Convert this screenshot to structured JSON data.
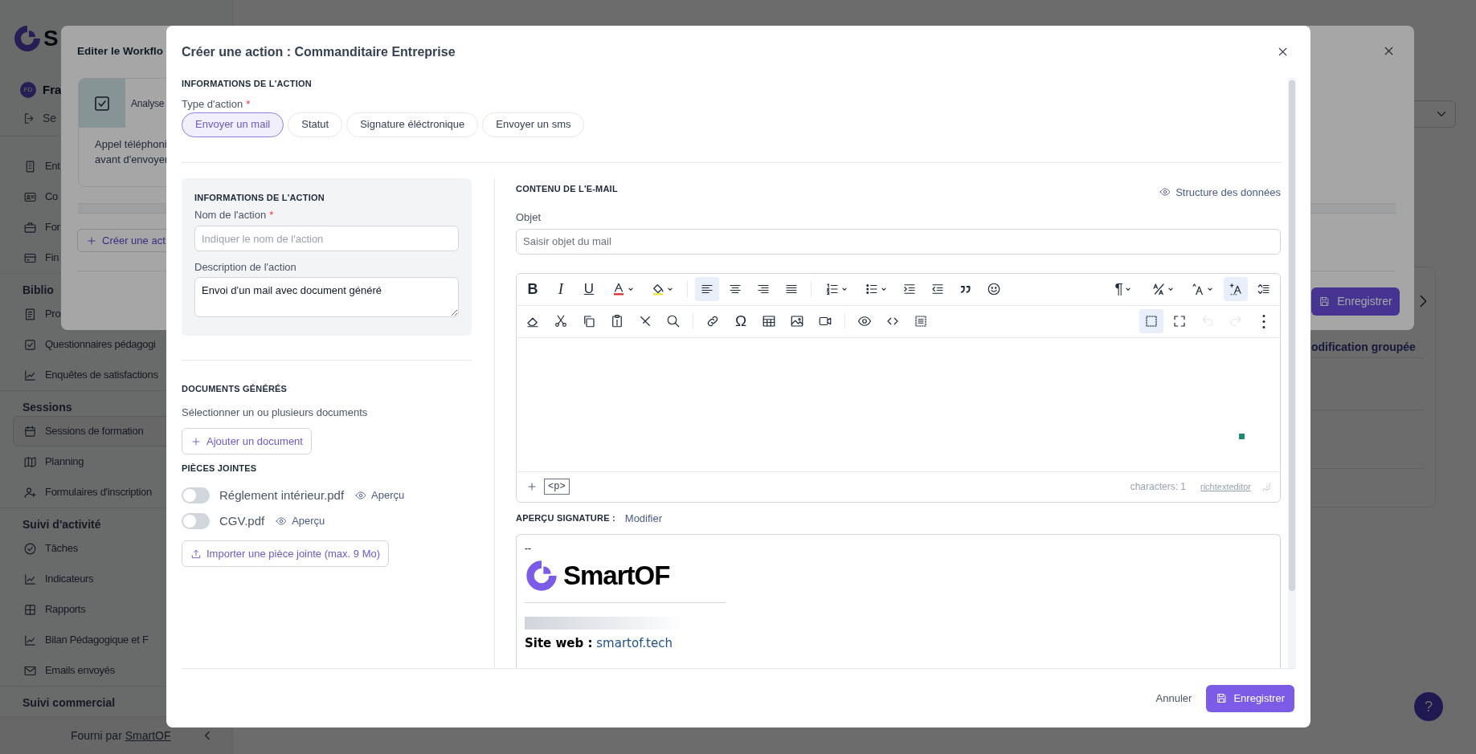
{
  "sidebar": {
    "logo_text": "S",
    "user": {
      "initials": "FD",
      "name": "Fra"
    },
    "logout": "Se",
    "groups": [
      {
        "items": [
          {
            "label": "Ent",
            "selected": false
          },
          {
            "label": "Co",
            "selected": false
          },
          {
            "label": "For",
            "selected": false
          },
          {
            "label": "Fin",
            "selected": false
          }
        ]
      },
      {
        "heading": "Biblio",
        "items": [
          {
            "label": "Pro",
            "selected": false
          },
          {
            "label": "Questionnaires pédagogi",
            "selected": false
          },
          {
            "label": "Enquêtes de satisfactions",
            "selected": false
          }
        ]
      },
      {
        "heading": "Sessions",
        "items": [
          {
            "label": "Sessions de formation",
            "selected": true
          },
          {
            "label": "Planning",
            "selected": false
          },
          {
            "label": "Formulaires d'inscription",
            "selected": false
          }
        ]
      },
      {
        "heading": "Suivi d'activité",
        "items": [
          {
            "label": "Tâches",
            "selected": false
          },
          {
            "label": "Indicateurs",
            "selected": false
          },
          {
            "label": "Rapports",
            "selected": false
          },
          {
            "label": "Bilan Pédagogique et F",
            "selected": false
          },
          {
            "label": "Emails envoyés",
            "selected": false
          }
        ]
      },
      {
        "heading": "Suivi commercial"
      }
    ],
    "footer": {
      "text": "Fourni par",
      "link": "SmartOF"
    }
  },
  "page": {
    "table_header": "odification groupée",
    "help_button": "?"
  },
  "workflow_modal": {
    "title": "Editer le Workflo",
    "step": {
      "title": "Analyse",
      "description_lines": [
        "Appel téléphoni",
        "avant d'envoyer"
      ]
    },
    "add_button": "Créer une act",
    "save_button": "Enregistrer"
  },
  "action_modal": {
    "title": "Créer une action : Commanditaire Entreprise",
    "section_label": "INFORMATIONS DE L'ACTION",
    "type_label": "Type d'action",
    "required_mark": "*",
    "types": [
      {
        "label": "Envoyer un mail",
        "selected": true
      },
      {
        "label": "Statut",
        "selected": false
      },
      {
        "label": "Signature éléctronique",
        "selected": false
      },
      {
        "label": "Envoyer un sms",
        "selected": false
      }
    ],
    "action_info": {
      "heading": "INFORMATIONS DE L'ACTION",
      "name": {
        "label": "Nom de l'action",
        "required_mark": "*",
        "placeholder": "Indiquer le nom de l'action"
      },
      "description": {
        "label": "Description de l'action",
        "value": "Envoi d’un mail avec document généré"
      }
    },
    "documents": {
      "heading": "DOCUMENTS GÉNÉRÉS",
      "hint": "Sélectionner un ou plusieurs documents",
      "add_button": "Ajouter un document"
    },
    "attachments": {
      "heading": "PIÈCES JOINTES",
      "files": [
        {
          "name": "Réglement intérieur.pdf",
          "on": false,
          "preview": "Aperçu"
        },
        {
          "name": "CGV.pdf",
          "on": false,
          "preview": "Aperçu"
        }
      ],
      "import_button": "Importer une pièce jointe (max. 9 Mo)"
    },
    "email": {
      "heading": "CONTENU DE L'E-MAIL",
      "structure_link": "Structure des données",
      "subject": {
        "label": "Objet",
        "placeholder": "Saisir objet du mail"
      },
      "editor": {
        "toolbar_rows": [
          {
            "left_groups": [
              [
                {
                  "glyph": "B",
                  "active": false,
                  "disabled": false,
                  "menu": false
                },
                {
                  "glyph": "I",
                  "active": false,
                  "disabled": false,
                  "menu": false
                },
                {
                  "glyph": "U",
                  "active": false,
                  "disabled": false,
                  "menu": false
                },
                {
                  "active": false,
                  "disabled": false,
                  "menu": true
                },
                {
                  "active": false,
                  "disabled": false,
                  "menu": true
                }
              ],
              [
                {
                  "active": true,
                  "disabled": false,
                  "menu": false
                },
                {
                  "active": false,
                  "disabled": false,
                  "menu": false
                },
                {
                  "active": false,
                  "disabled": false,
                  "menu": false
                },
                {
                  "active": false,
                  "disabled": false,
                  "menu": false
                }
              ],
              [
                {
                  "active": false,
                  "disabled": false,
                  "menu": true
                },
                {
                  "active": false,
                  "disabled": false,
                  "menu": true
                },
                {
                  "active": false,
                  "disabled": false,
                  "menu": false
                },
                {
                  "active": false,
                  "disabled": false,
                  "menu": false
                },
                {
                  "active": false,
                  "disabled": false,
                  "menu": false
                },
                {
                  "active": false,
                  "disabled": false,
                  "menu": false
                }
              ]
            ],
            "right": [
              {
                "glyph": "¶",
                "active": false,
                "disabled": false,
                "menu": true
              },
              {
                "active": false,
                "disabled": false,
                "menu": true
              },
              {
                "active": false,
                "disabled": false,
                "menu": true
              },
              {
                "active": true,
                "disabled": false,
                "menu": false
              },
              {
                "active": false,
                "disabled": false,
                "menu": false
              }
            ]
          },
          {
            "left_groups": [
              [
                {
                  "active": false,
                  "disabled": false,
                  "menu": false
                },
                {
                  "active": false,
                  "disabled": false,
                  "menu": false
                },
                {
                  "active": false,
                  "disabled": false,
                  "menu": false
                },
                {
                  "active": false,
                  "disabled": false,
                  "menu": false
                },
                {
                  "active": false,
                  "disabled": false,
                  "menu": false
                },
                {
                  "active": false,
                  "disabled": false,
                  "menu": false
                }
              ],
              [
                {
                  "active": false,
                  "disabled": false,
                  "menu": false
                },
                {
                  "glyph": "Ω",
                  "active": false,
                  "disabled": false,
                  "menu": false
                },
                {
                  "active": false,
                  "disabled": false,
                  "menu": false
                },
                {
                  "active": false,
                  "disabled": false,
                  "menu": false
                },
                {
                  "active": false,
                  "disabled": false,
                  "menu": false
                }
              ],
              [
                {
                  "active": false,
                  "disabled": false,
                  "menu": false
                },
                {
                  "active": false,
                  "disabled": false,
                  "menu": false
                },
                {
                  "active": false,
                  "disabled": false,
                  "menu": false
                }
              ]
            ],
            "right": [
              {
                "active": true,
                "disabled": false,
                "menu": false
              },
              {
                "active": false,
                "disabled": false,
                "menu": false
              },
              {
                "active": false,
                "disabled": true,
                "menu": false
              },
              {
                "active": false,
                "disabled": true,
                "menu": false
              },
              {
                "active": false,
                "disabled": false,
                "menu": false
              }
            ]
          }
        ],
        "footer": {
          "tag": "<p>",
          "characters": "characters: 1",
          "brand": "richtexteditor"
        }
      },
      "signature": {
        "label": "APERÇU SIGNATURE :",
        "edit_link": "Modifier",
        "dash": "--",
        "logo_text": "SmartOF",
        "site_label": "Site web :",
        "site_link": "smartof.tech"
      }
    },
    "footer": {
      "cancel": "Annuler",
      "save": "Enregistrer"
    }
  }
}
